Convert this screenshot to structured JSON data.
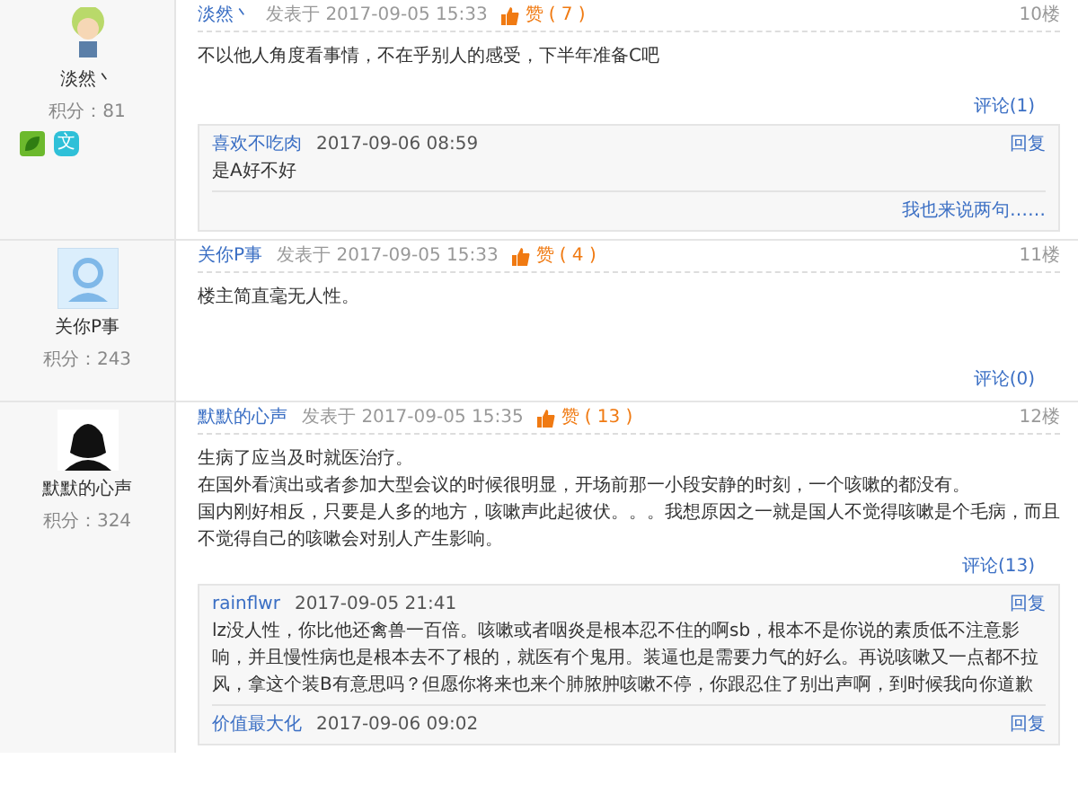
{
  "posts": [
    {
      "author": "淡然丶",
      "avatar": {
        "kind": "cartoon"
      },
      "score": "积分：81",
      "badges": [
        {
          "kind": "leaf"
        },
        {
          "kind": "text",
          "label": "文"
        }
      ],
      "author_link": "淡然丶",
      "posted_prefix": "发表于",
      "date": "2017-09-05 15:33",
      "like_label": "赞",
      "like_count": "( 7 )",
      "floor": "10楼",
      "body": [
        "不以他人角度看事情，不在乎别人的感受，下半年准备C吧"
      ],
      "comment_link": "评论(1)",
      "comments": [
        {
          "author": "喜欢不吃肉",
          "time": "2017-09-06 08:59",
          "text": "是A好不好",
          "reply": "回复"
        }
      ],
      "comment_footer": "我也来说两句……"
    },
    {
      "author": "关你P事",
      "avatar": {
        "kind": "default"
      },
      "score": "积分：243",
      "author_link": "关你P事",
      "posted_prefix": "发表于",
      "date": "2017-09-05 15:33",
      "like_label": "赞",
      "like_count": "( 4 )",
      "floor": "11楼",
      "body": [
        "楼主简直毫无人性。"
      ],
      "comment_link": "评论(0)"
    },
    {
      "author": "默默的心声",
      "avatar": {
        "kind": "silhouette"
      },
      "score": "积分：324",
      "author_link": "默默的心声",
      "posted_prefix": "发表于",
      "date": "2017-09-05 15:35",
      "like_label": "赞",
      "like_count": "( 13 )",
      "floor": "12楼",
      "body": [
        "生病了应当及时就医治疗。",
        "在国外看演出或者参加大型会议的时候很明显，开场前那一小段安静的时刻，一个咳嗽的都没有。",
        "国内刚好相反，只要是人多的地方，咳嗽声此起彼伏。。。我想原因之一就是国人不觉得咳嗽是个毛病，而且不觉得自己的咳嗽会对别人产生影响。"
      ],
      "comment_link": "评论(13)",
      "comments": [
        {
          "author": "rainflwr",
          "time": "2017-09-05 21:41",
          "text": "lz没人性，你比他还禽兽一百倍。咳嗽或者咽炎是根本忍不住的啊sb，根本不是你说的素质低不注意影响，并且慢性病也是根本去不了根的，就医有个鬼用。装逼也是需要力气的好么。再说咳嗽又一点都不拉风，拿这个装B有意思吗？但愿你将来也来个肺脓肿咳嗽不停，你跟忍住了别出声啊，到时候我向你道歉",
          "reply": "回复"
        },
        {
          "author": "价值最大化",
          "time": "2017-09-06 09:02",
          "reply": "回复"
        }
      ]
    }
  ]
}
